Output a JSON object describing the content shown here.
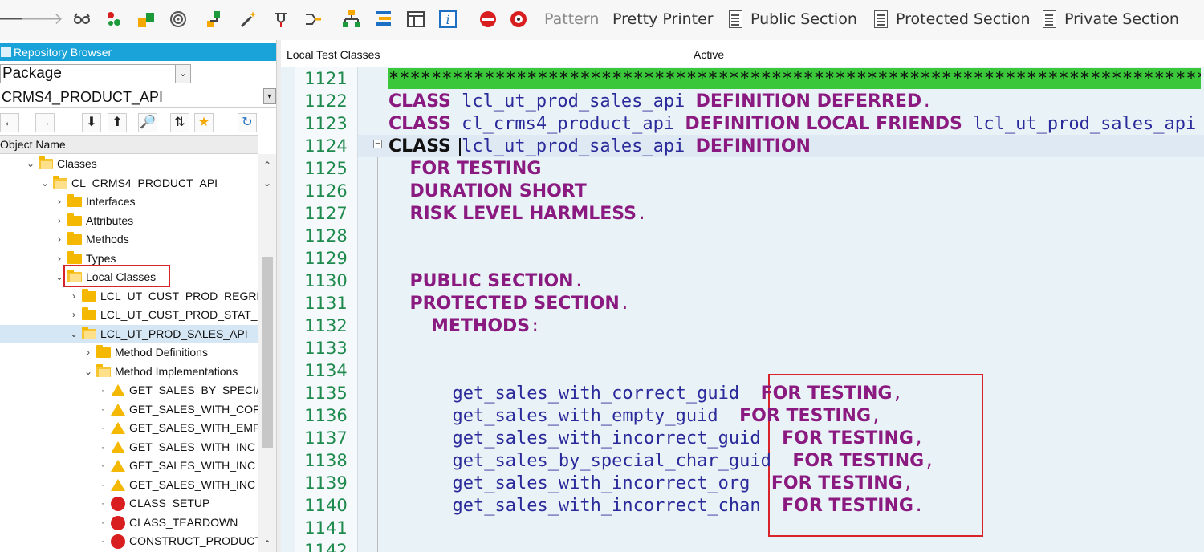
{
  "toolbar": {
    "pattern": "Pattern",
    "pretty_printer": "Pretty Printer",
    "public_section": "Public Section",
    "protected_section": "Protected Section",
    "private_section": "Private Section",
    "icons": [
      "back-arrow-icon",
      "forward-arrow-icon",
      "glasses-icon",
      "objects-icon",
      "transport-icon",
      "target-icon",
      "hierarchy-icon",
      "magic-wand-icon",
      "pin-icon",
      "branch-icon",
      "tree-structure-icon",
      "list-structure-icon",
      "window-icon",
      "info-icon",
      "stop-debug-icon",
      "debug-icon"
    ]
  },
  "repository": {
    "title": "Repository Browser",
    "object_type": "Package",
    "package_name": "CRMS4_PRODUCT_API",
    "column_header": "Object Name"
  },
  "tree": [
    {
      "label": "Classes",
      "kind": "folder-open",
      "chev": "⌄",
      "indent": 0
    },
    {
      "label": "CL_CRMS4_PRODUCT_API",
      "kind": "folder-open",
      "chev": "⌄",
      "indent": 1
    },
    {
      "label": "Interfaces",
      "kind": "folder",
      "chev": "›",
      "indent": 2
    },
    {
      "label": "Attributes",
      "kind": "folder",
      "chev": "›",
      "indent": 2
    },
    {
      "label": "Methods",
      "kind": "folder",
      "chev": "›",
      "indent": 2
    },
    {
      "label": "Types",
      "kind": "folder",
      "chev": "›",
      "indent": 2
    },
    {
      "label": "Local Classes",
      "kind": "folder-open",
      "chev": "⌄",
      "indent": 2
    },
    {
      "label": "LCL_UT_CUST_PROD_REGRE",
      "kind": "folder",
      "chev": "›",
      "indent": 3
    },
    {
      "label": "LCL_UT_CUST_PROD_STAT_",
      "kind": "folder",
      "chev": "›",
      "indent": 3
    },
    {
      "label": "LCL_UT_PROD_SALES_API",
      "kind": "folder-open",
      "chev": "⌄",
      "indent": 3,
      "selected": true
    },
    {
      "label": "Method Definitions",
      "kind": "folder",
      "chev": "›",
      "indent": 4
    },
    {
      "label": "Method Implementations",
      "kind": "folder-open",
      "chev": "⌄",
      "indent": 4
    },
    {
      "label": "GET_SALES_BY_SPECI/",
      "kind": "warning",
      "chev": "·",
      "indent": 5
    },
    {
      "label": "GET_SALES_WITH_COF",
      "kind": "warning",
      "chev": "·",
      "indent": 5
    },
    {
      "label": "GET_SALES_WITH_EMF",
      "kind": "warning",
      "chev": "·",
      "indent": 5
    },
    {
      "label": "GET_SALES_WITH_INC",
      "kind": "warning",
      "chev": "·",
      "indent": 5
    },
    {
      "label": "GET_SALES_WITH_INC",
      "kind": "warning",
      "chev": "·",
      "indent": 5
    },
    {
      "label": "GET_SALES_WITH_INC",
      "kind": "warning",
      "chev": "·",
      "indent": 5
    },
    {
      "label": "CLASS_SETUP",
      "kind": "error",
      "chev": "·",
      "indent": 5
    },
    {
      "label": "CLASS_TEARDOWN",
      "kind": "error",
      "chev": "·",
      "indent": 5
    },
    {
      "label": "CONSTRUCT_PRODUCT",
      "kind": "error",
      "chev": "·",
      "indent": 5
    }
  ],
  "editor": {
    "title": "Local Test Classes",
    "status": "Active",
    "stars": "******************************************************************************************",
    "lines": [
      {
        "no": "1121",
        "tokens": []
      },
      {
        "no": "1122",
        "tokens": [
          [
            "kw",
            "CLASS"
          ],
          [
            "sp",
            " "
          ],
          [
            "id",
            "lcl_ut_prod_sales_api"
          ],
          [
            "sp",
            " "
          ],
          [
            "kw",
            "DEFINITION DEFERRED"
          ],
          [
            "dot",
            "."
          ]
        ]
      },
      {
        "no": "1123",
        "tokens": [
          [
            "kw",
            "CLASS"
          ],
          [
            "sp",
            " "
          ],
          [
            "id",
            "cl_crms4_product_api"
          ],
          [
            "sp",
            " "
          ],
          [
            "kw",
            "DEFINITION LOCAL FRIENDS"
          ],
          [
            "sp",
            " "
          ],
          [
            "id",
            "lcl_ut_prod_sales_api"
          ]
        ]
      },
      {
        "no": "1124",
        "tokens": [
          [
            "kwb",
            "CLASS"
          ],
          [
            "sp",
            " "
          ],
          [
            "id",
            "lcl_ut_prod_sales_api"
          ],
          [
            "sp",
            " "
          ],
          [
            "kw",
            "DEFINITION"
          ]
        ]
      },
      {
        "no": "1125",
        "tokens": [
          [
            "sp",
            "  "
          ],
          [
            "kw",
            "FOR TESTING"
          ]
        ]
      },
      {
        "no": "1126",
        "tokens": [
          [
            "sp",
            "  "
          ],
          [
            "kw",
            "DURATION SHORT"
          ]
        ]
      },
      {
        "no": "1127",
        "tokens": [
          [
            "sp",
            "  "
          ],
          [
            "kw",
            "RISK LEVEL HARMLESS"
          ],
          [
            "dot",
            "."
          ]
        ]
      },
      {
        "no": "1128",
        "tokens": []
      },
      {
        "no": "1129",
        "tokens": []
      },
      {
        "no": "1130",
        "tokens": [
          [
            "sp",
            "  "
          ],
          [
            "kw",
            "PUBLIC SECTION"
          ],
          [
            "dot",
            "."
          ]
        ]
      },
      {
        "no": "1131",
        "tokens": [
          [
            "sp",
            "  "
          ],
          [
            "kw",
            "PROTECTED SECTION"
          ],
          [
            "dot",
            "."
          ]
        ]
      },
      {
        "no": "1132",
        "tokens": [
          [
            "sp",
            "    "
          ],
          [
            "kw",
            "METHODS"
          ],
          [
            "dot",
            ":"
          ]
        ]
      },
      {
        "no": "1133",
        "tokens": []
      },
      {
        "no": "1134",
        "tokens": []
      },
      {
        "no": "1135",
        "tokens": [
          [
            "sp",
            "      "
          ],
          [
            "id",
            "get_sales_with_correct_guid"
          ],
          [
            "sp",
            "  "
          ],
          [
            "kw",
            "FOR TESTING"
          ],
          [
            "dot",
            ","
          ]
        ]
      },
      {
        "no": "1136",
        "tokens": [
          [
            "sp",
            "      "
          ],
          [
            "id",
            "get_sales_with_empty_guid"
          ],
          [
            "sp",
            "  "
          ],
          [
            "kw",
            "FOR TESTING"
          ],
          [
            "dot",
            ","
          ]
        ]
      },
      {
        "no": "1137",
        "tokens": [
          [
            "sp",
            "      "
          ],
          [
            "id",
            "get_sales_with_incorrect_guid"
          ],
          [
            "sp",
            "  "
          ],
          [
            "kw",
            "FOR TESTING"
          ],
          [
            "dot",
            ","
          ]
        ]
      },
      {
        "no": "1138",
        "tokens": [
          [
            "sp",
            "      "
          ],
          [
            "id",
            "get_sales_by_special_char_guid"
          ],
          [
            "sp",
            "  "
          ],
          [
            "kw",
            "FOR TESTING"
          ],
          [
            "dot",
            ","
          ]
        ]
      },
      {
        "no": "1139",
        "tokens": [
          [
            "sp",
            "      "
          ],
          [
            "id",
            "get_sales_with_incorrect_org"
          ],
          [
            "sp",
            "  "
          ],
          [
            "kw",
            "FOR TESTING"
          ],
          [
            "dot",
            ","
          ]
        ]
      },
      {
        "no": "1140",
        "tokens": [
          [
            "sp",
            "      "
          ],
          [
            "id",
            "get_sales_with_incorrect_chan"
          ],
          [
            "sp",
            "  "
          ],
          [
            "kw",
            "FOR TESTING"
          ],
          [
            "dot",
            "."
          ]
        ]
      },
      {
        "no": "1141",
        "tokens": []
      },
      {
        "no": "1142",
        "tokens": []
      }
    ]
  },
  "colors": {
    "accent": "#1aa3d9",
    "keyword": "#8a1a80",
    "identifier": "#2a2a9a",
    "line_number": "#1f8a4e",
    "highlight_box": "#d8232a",
    "comment_bar": "#3ac83a"
  }
}
